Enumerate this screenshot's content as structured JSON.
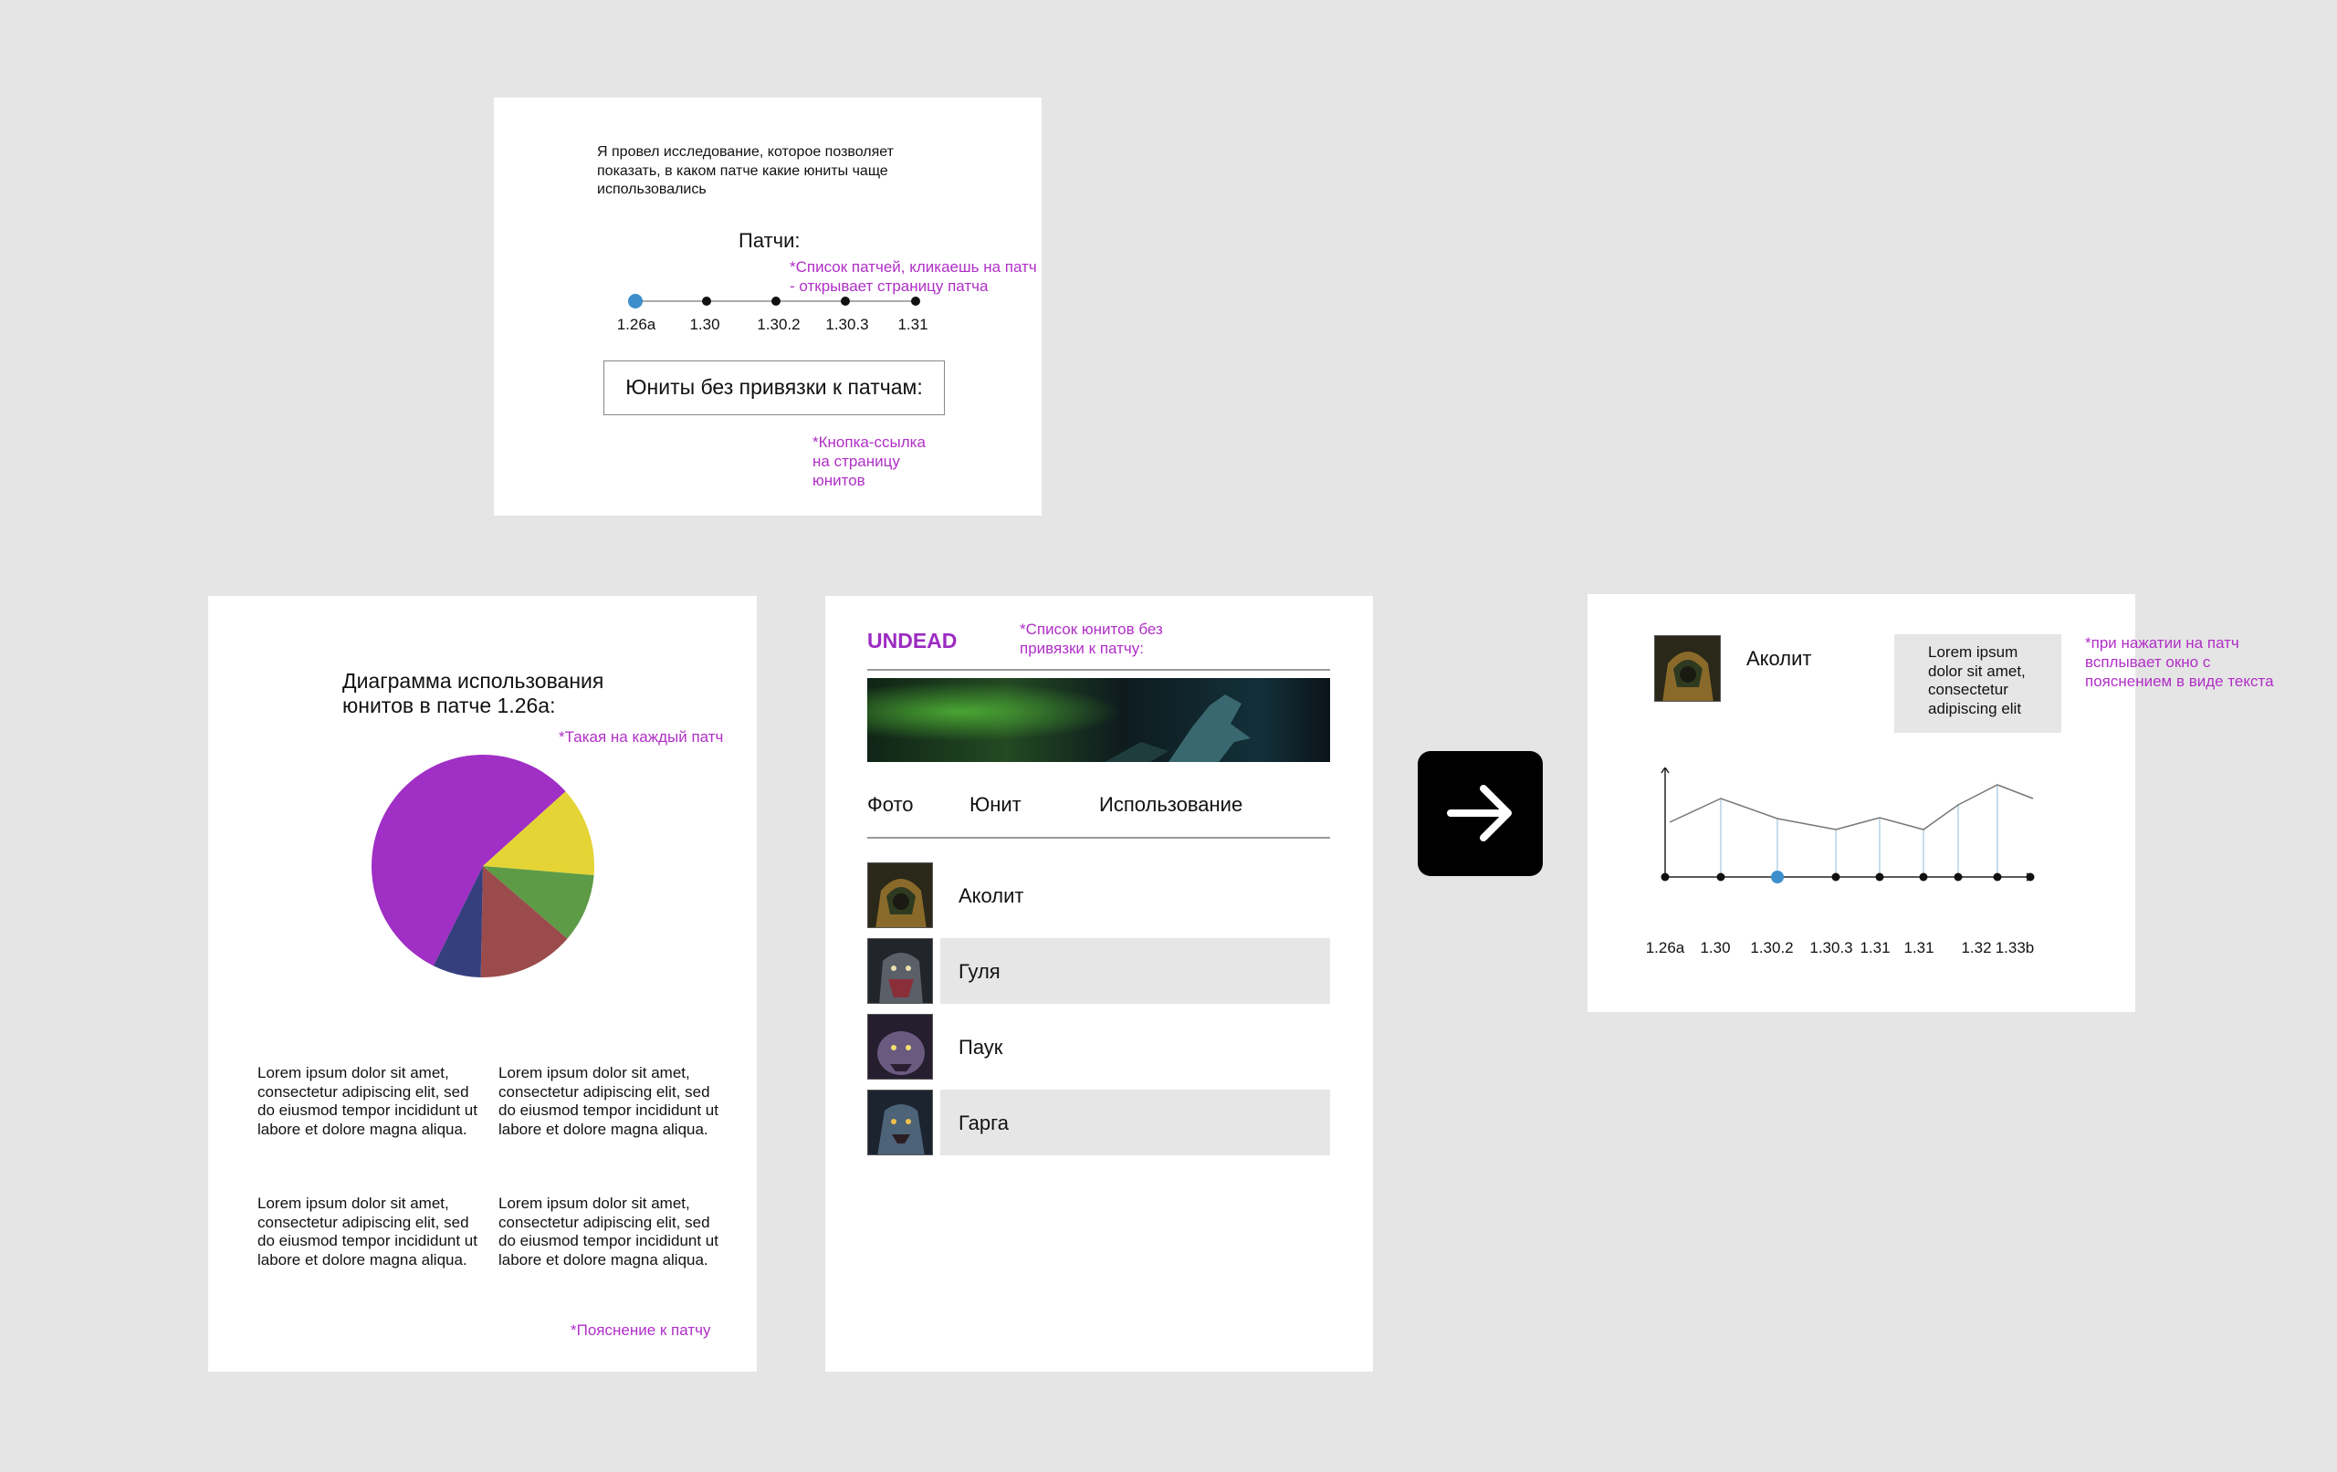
{
  "frame_intro": {
    "description": "Я провел исследование, которое позволяет показать, в каком патче какие юниты чаще использовались",
    "patches_title": "Патчи:",
    "patches_note": "*Список патчей, кликаешь на патч - открывает страницу патча",
    "patches": [
      "1.26a",
      "1.30",
      "1.30.2",
      "1.30.3",
      "1.31"
    ],
    "units_button": "Юниты без привязки к патчам:",
    "units_button_note": "*Кнопка-ссылка на страницу юнитов"
  },
  "frame_patch": {
    "title_line1": "Диаграмма использования",
    "title_line2": "юнитов в патче 1.26а:",
    "note_each_patch": "*Такая на каждый патч",
    "lorem": "Lorem ipsum dolor sit amet, consectetur adipiscing elit, sed do eiusmod tempor incididunt ut labore et dolore magna aliqua.",
    "note_explanation": "*Пояснение к патчу"
  },
  "chart_data": {
    "type": "pie",
    "values": [
      56,
      13,
      10,
      14,
      7
    ],
    "colors": [
      "#a02fc5",
      "#e4d435",
      "#5d9b47",
      "#9b4b4b",
      "#363f7e"
    ]
  },
  "frame_units": {
    "race": "UNDEAD",
    "note": "*Список юнитов без привязки к патчу:",
    "columns": [
      "Фото",
      "Юнит",
      "Использование"
    ],
    "units": [
      "Аколит",
      "Гуля",
      "Паук",
      "Гарга"
    ]
  },
  "frame_unit": {
    "unit_name": "Аколит",
    "tooltip": "Lorem ipsum dolor sit amet, consectetur adipiscing elit",
    "note": "*при нажатии на патч всплывает окно с пояснением в виде текста",
    "chart_ticks": [
      "1.26a",
      "1.30",
      "1.30.2",
      "1.30.3",
      "1.31",
      "1.31",
      "1.32",
      "1.33b"
    ]
  },
  "colors": {
    "background": "#e5e5e5",
    "accent": "#b02fc7",
    "active_dot": "#3d8fcb"
  }
}
